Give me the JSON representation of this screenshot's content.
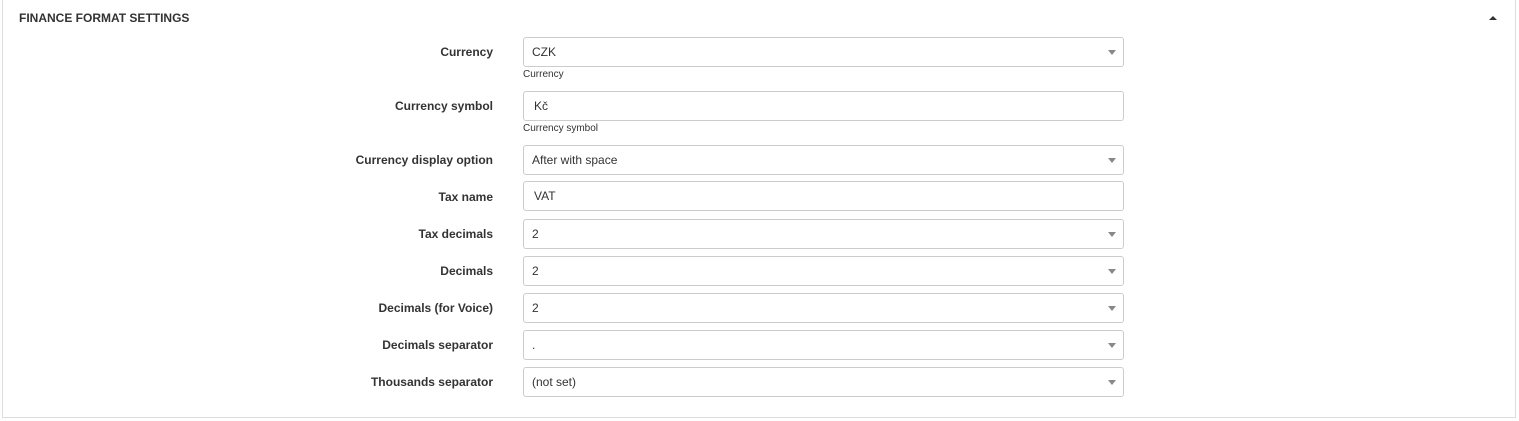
{
  "panel": {
    "title": "FINANCE FORMAT SETTINGS"
  },
  "icons": {
    "collapse": "caret-up-icon",
    "dropdown": "caret-down-icon"
  },
  "fields": {
    "currency": {
      "label": "Currency",
      "value": "CZK",
      "hint": "Currency"
    },
    "currency_symbol": {
      "label": "Currency symbol",
      "value": "Kč",
      "hint": "Currency symbol"
    },
    "currency_display_option": {
      "label": "Currency display option",
      "value": "After with space"
    },
    "tax_name": {
      "label": "Tax name",
      "value": "VAT"
    },
    "tax_decimals": {
      "label": "Tax decimals",
      "value": "2"
    },
    "decimals": {
      "label": "Decimals",
      "value": "2"
    },
    "decimals_voice": {
      "label": "Decimals (for Voice)",
      "value": "2"
    },
    "decimals_separator": {
      "label": "Decimals separator",
      "value": "."
    },
    "thousands_separator": {
      "label": "Thousands separator",
      "value": "(not set)"
    }
  }
}
